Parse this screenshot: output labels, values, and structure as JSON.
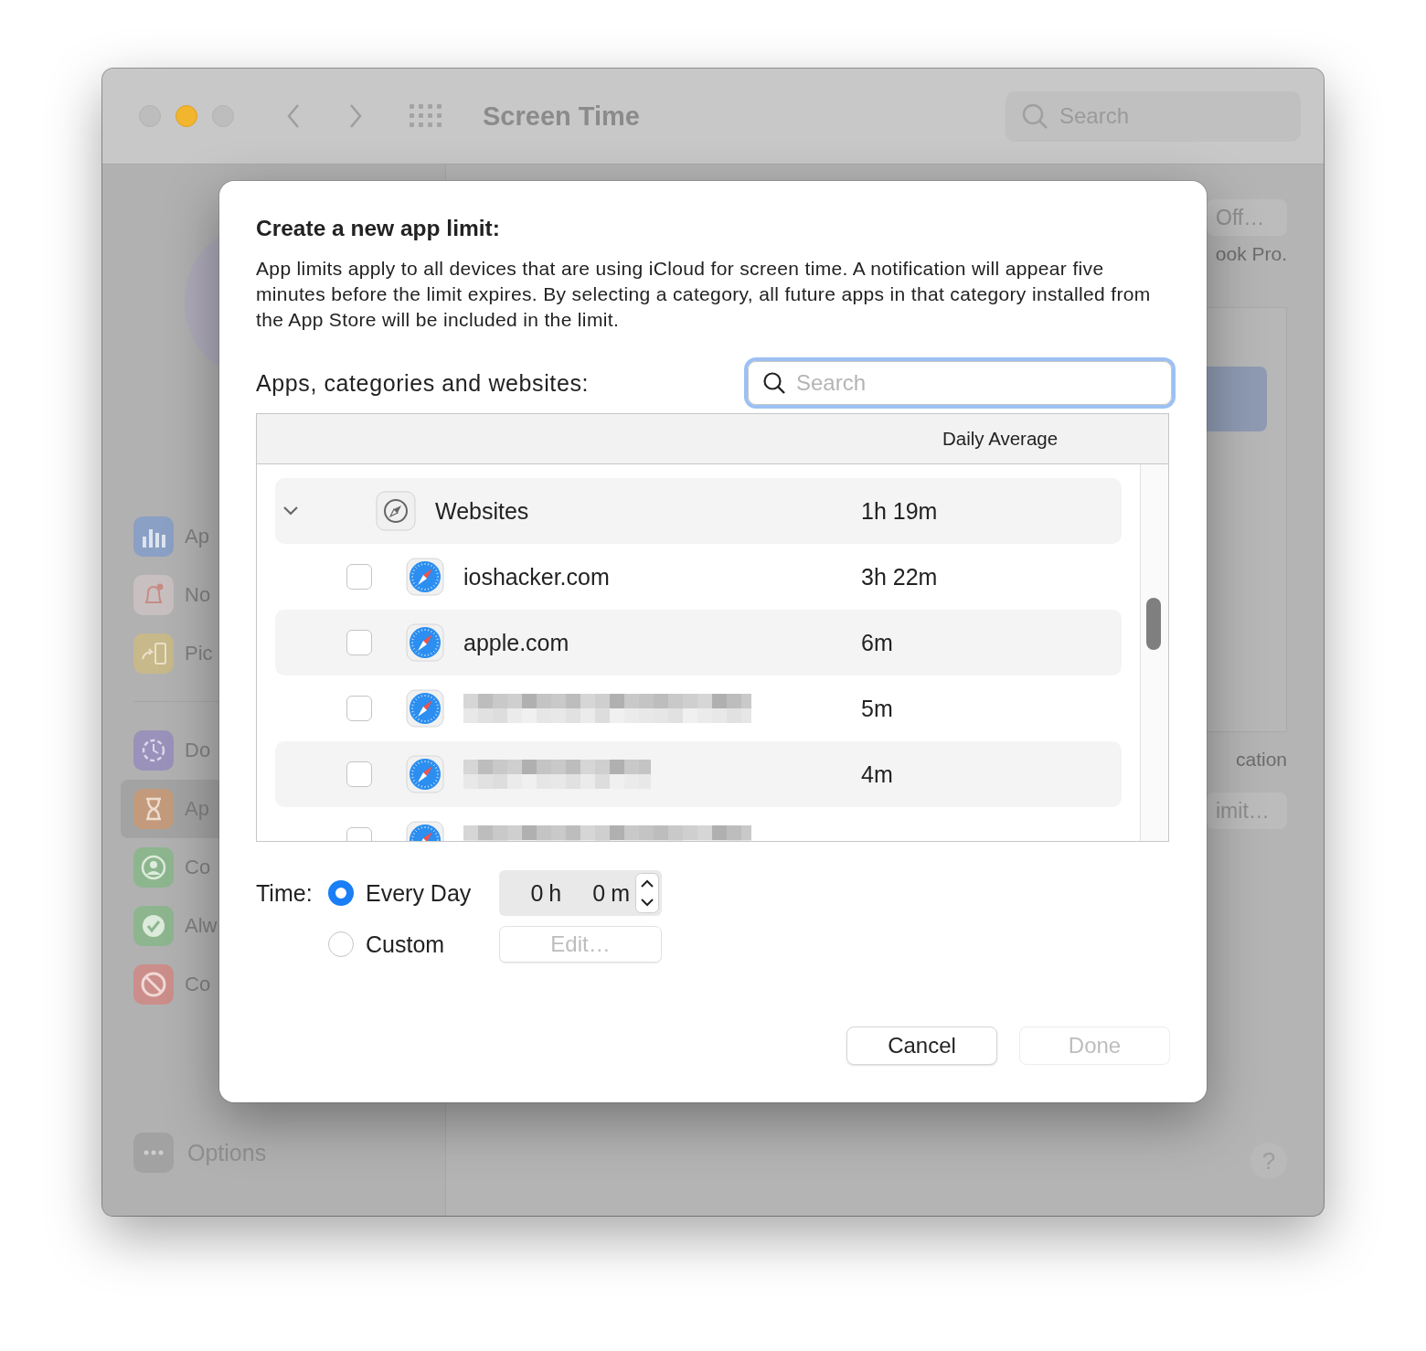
{
  "window": {
    "title": "Screen Time",
    "search_placeholder": "Search"
  },
  "sidebar": {
    "items": [
      {
        "label": "Ap",
        "kind": "usage",
        "selected": false
      },
      {
        "label": "No",
        "kind": "notifications",
        "selected": false
      },
      {
        "label": "Pic",
        "kind": "pickups",
        "selected": false
      },
      {
        "label": "Do",
        "kind": "downtime",
        "selected": false
      },
      {
        "label": "Ap",
        "kind": "limits",
        "selected": true
      },
      {
        "label": "Co",
        "kind": "communication",
        "selected": false
      },
      {
        "label": "Alw",
        "kind": "allowed",
        "selected": false
      },
      {
        "label": "Co",
        "kind": "content",
        "selected": false
      }
    ],
    "options": "Options"
  },
  "right_pane": {
    "top_button": "Off…",
    "device_text": "ook Pro.",
    "note": "cation",
    "limit_button": "imit…",
    "help": "?"
  },
  "dialog": {
    "title": "Create a new app limit:",
    "description": "App limits apply to all devices that are using iCloud for screen time. A notification will appear five minutes before the limit expires. By selecting a category, all future apps in that category installed from the App Store will be included in the limit.",
    "list_label": "Apps, categories and websites:",
    "search_placeholder": "Search",
    "column_header": "Daily Average",
    "rows": [
      {
        "kind": "category",
        "name": "Websites",
        "time": "1h 19m",
        "expanded": true
      },
      {
        "kind": "site",
        "name": "ioshacker.com",
        "time": "3h 22m",
        "checked": false
      },
      {
        "kind": "site",
        "name": "apple.com",
        "time": "6m",
        "checked": false
      },
      {
        "kind": "redacted",
        "time": "5m",
        "checked": false
      },
      {
        "kind": "redacted",
        "time": "4m",
        "checked": false
      },
      {
        "kind": "redacted",
        "checked": false
      }
    ],
    "time": {
      "label": "Time:",
      "options": [
        {
          "label": "Every Day",
          "selected": true
        },
        {
          "label": "Custom",
          "selected": false
        }
      ],
      "hours": "0",
      "hours_unit": "h",
      "minutes": "0",
      "minutes_unit": "m",
      "edit_button": {
        "label": "Edit…",
        "disabled": true
      }
    },
    "buttons": [
      {
        "label": "Cancel",
        "disabled": false
      },
      {
        "label": "Done",
        "disabled": true
      }
    ]
  }
}
